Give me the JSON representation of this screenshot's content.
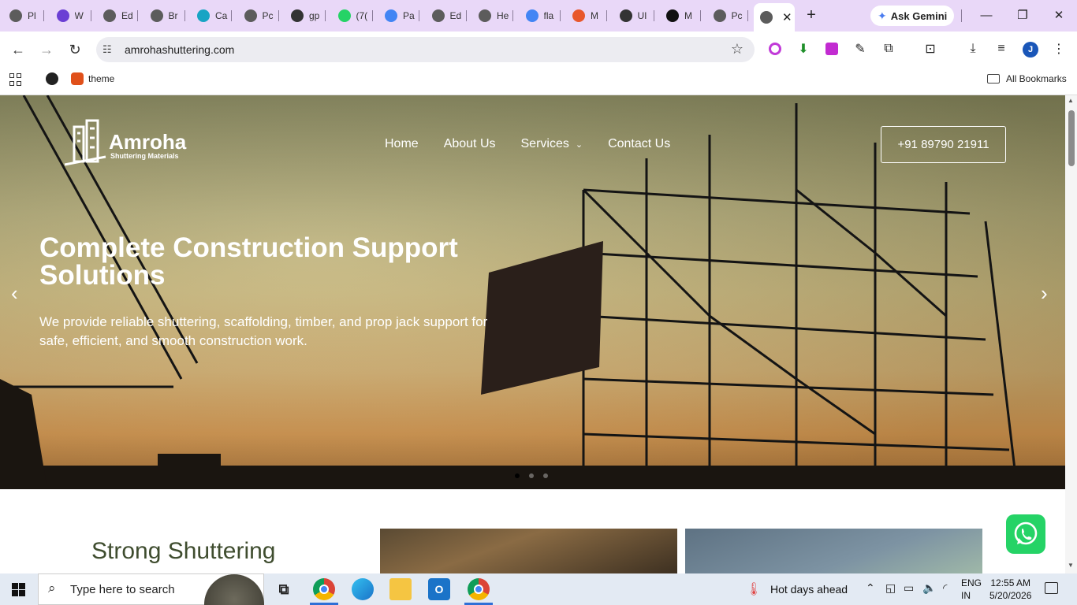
{
  "browser": {
    "tabs": [
      {
        "title": "Pl",
        "color": "#5c5c5c"
      },
      {
        "title": "W",
        "color": "#6b3fd4"
      },
      {
        "title": "Ed",
        "color": "#5c5c5c"
      },
      {
        "title": "Br",
        "color": "#5c5c5c"
      },
      {
        "title": "Ca",
        "color": "#18a4c4"
      },
      {
        "title": "Pc",
        "color": "#5c5c5c"
      },
      {
        "title": "gp",
        "color": "#333333"
      },
      {
        "title": "(7(",
        "color": "#25d366"
      },
      {
        "title": "Pa",
        "color": "#4285f4"
      },
      {
        "title": "Ed",
        "color": "#5c5c5c"
      },
      {
        "title": "He",
        "color": "#5c5c5c"
      },
      {
        "title": "fla",
        "color": "#4285f4"
      },
      {
        "title": "M",
        "color": "#e8572c"
      },
      {
        "title": "UI",
        "color": "#333333"
      },
      {
        "title": "M",
        "color": "#111111"
      },
      {
        "title": "Pc",
        "color": "#5c5c5c"
      }
    ],
    "active_tab_close": "✕",
    "new_tab": "+",
    "ask_gemini": "Ask Gemini",
    "url": "amrohashuttering.com",
    "bookmarks": {
      "theme": "theme",
      "all_bookmarks": "All Bookmarks"
    },
    "avatar_letter": "J"
  },
  "site": {
    "logo_name": "Amroha",
    "logo_tagline": "Shuttering Materials",
    "nav": {
      "home": "Home",
      "about": "About Us",
      "services": "Services",
      "contact": "Contact Us"
    },
    "phone": "+91 89790 21911",
    "hero_title": "Complete Construction Support Solutions",
    "hero_text": "We provide reliable shuttering, scaffolding, timber, and prop jack support for safe, efficient, and smooth construction work.",
    "active_slide": 1,
    "slide_count": 3,
    "section_title": "Strong Shuttering"
  },
  "taskbar": {
    "search_placeholder": "Type here to search",
    "weather": "Hot days ahead",
    "lang_line1": "ENG",
    "lang_line2": "IN",
    "time": "12:55 AM",
    "date": "5/20/2026"
  },
  "colors": {
    "tabstrip": "#e9d8f8",
    "section_title": "#3f4d2f",
    "whatsapp": "#25d366"
  }
}
